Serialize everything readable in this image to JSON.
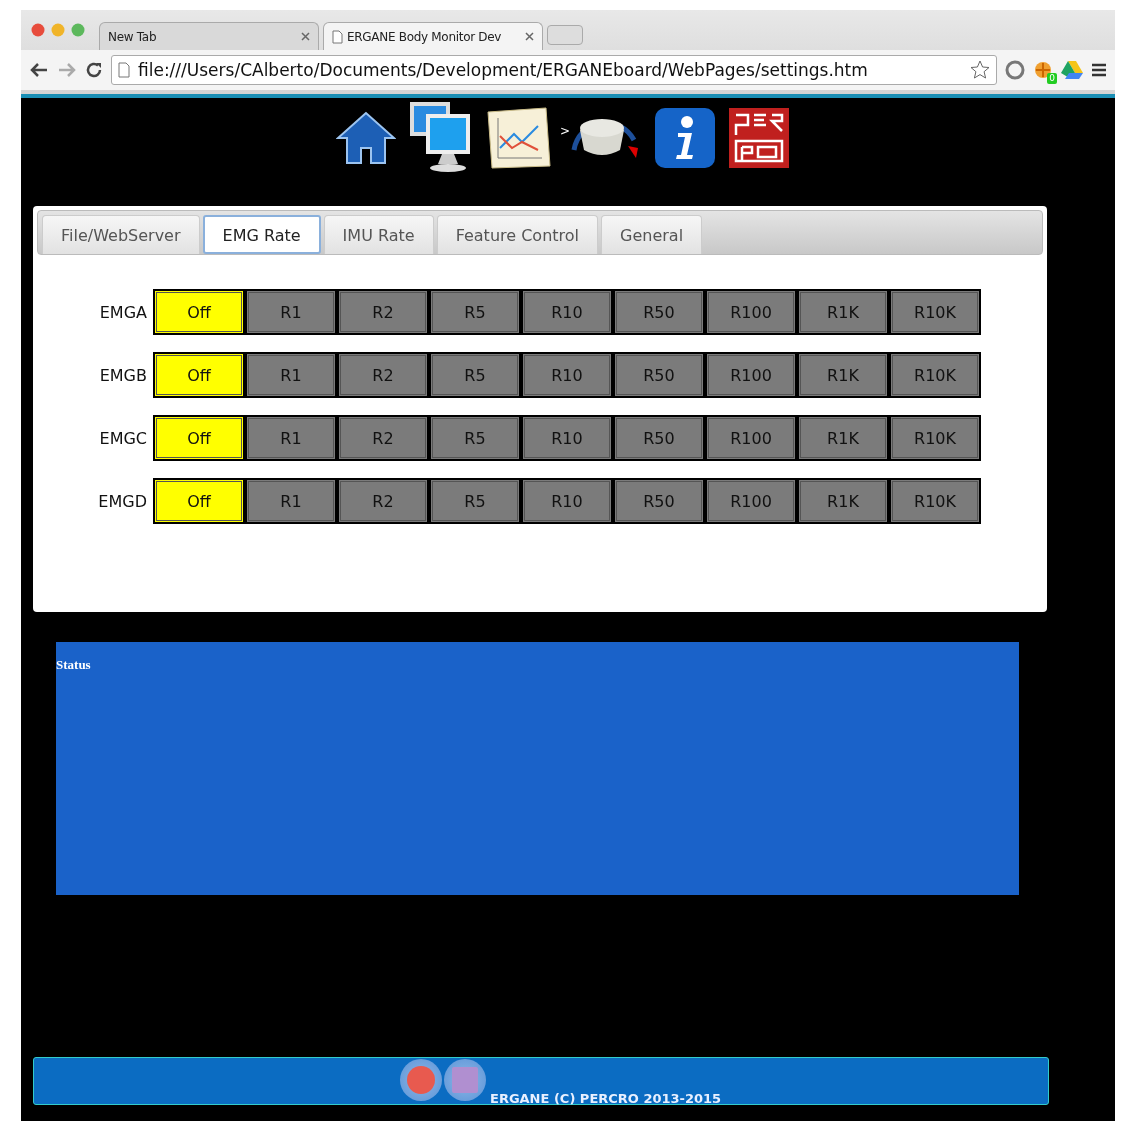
{
  "browser": {
    "tabs": [
      {
        "title": "New Tab",
        "selected": false
      },
      {
        "title": "ERGANE Body Monitor Dev",
        "selected": true
      }
    ],
    "address": "file:///Users/CAlberto/Documents/Development/ERGANEboard/WebPages/settings.htm",
    "extension_badge": "0"
  },
  "nav": {
    "arrow": ">"
  },
  "settings_tabs": [
    {
      "label": "File/WebServer",
      "selected": false
    },
    {
      "label": "EMG Rate",
      "selected": true
    },
    {
      "label": "IMU Rate",
      "selected": false
    },
    {
      "label": "Feature Control",
      "selected": false
    },
    {
      "label": "General",
      "selected": false
    }
  ],
  "channels": [
    {
      "label": "EMGA",
      "options": [
        {
          "label": "Off",
          "selected": true
        },
        {
          "label": "R1",
          "selected": false
        },
        {
          "label": "R2",
          "selected": false
        },
        {
          "label": "R5",
          "selected": false
        },
        {
          "label": "R10",
          "selected": false
        },
        {
          "label": "R50",
          "selected": false
        },
        {
          "label": "R100",
          "selected": false
        },
        {
          "label": "R1K",
          "selected": false
        },
        {
          "label": "R10K",
          "selected": false
        }
      ]
    },
    {
      "label": "EMGB",
      "options": [
        {
          "label": "Off",
          "selected": true
        },
        {
          "label": "R1",
          "selected": false
        },
        {
          "label": "R2",
          "selected": false
        },
        {
          "label": "R5",
          "selected": false
        },
        {
          "label": "R10",
          "selected": false
        },
        {
          "label": "R50",
          "selected": false
        },
        {
          "label": "R100",
          "selected": false
        },
        {
          "label": "R1K",
          "selected": false
        },
        {
          "label": "R10K",
          "selected": false
        }
      ]
    },
    {
      "label": "EMGC",
      "options": [
        {
          "label": "Off",
          "selected": true
        },
        {
          "label": "R1",
          "selected": false
        },
        {
          "label": "R2",
          "selected": false
        },
        {
          "label": "R5",
          "selected": false
        },
        {
          "label": "R10",
          "selected": false
        },
        {
          "label": "R50",
          "selected": false
        },
        {
          "label": "R100",
          "selected": false
        },
        {
          "label": "R1K",
          "selected": false
        },
        {
          "label": "R10K",
          "selected": false
        }
      ]
    },
    {
      "label": "EMGD",
      "options": [
        {
          "label": "Off",
          "selected": true
        },
        {
          "label": "R1",
          "selected": false
        },
        {
          "label": "R2",
          "selected": false
        },
        {
          "label": "R5",
          "selected": false
        },
        {
          "label": "R10",
          "selected": false
        },
        {
          "label": "R50",
          "selected": false
        },
        {
          "label": "R100",
          "selected": false
        },
        {
          "label": "R1K",
          "selected": false
        },
        {
          "label": "R10K",
          "selected": false
        }
      ]
    }
  ],
  "status": {
    "title": "Status"
  },
  "footer": {
    "text": "ERGANE (C) PERCRO 2013-2015"
  }
}
